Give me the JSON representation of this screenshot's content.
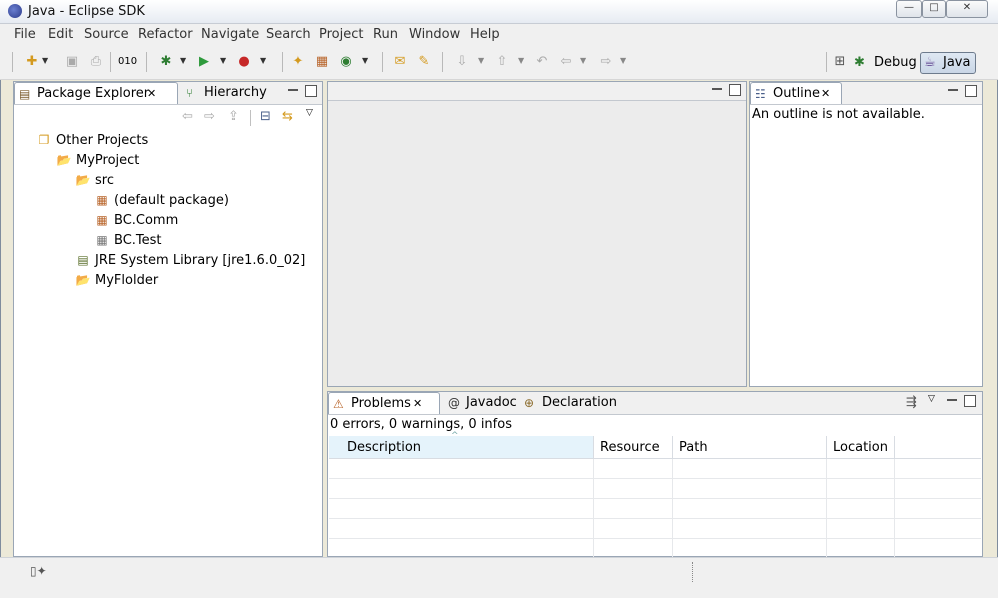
{
  "window": {
    "title": "Java - Eclipse SDK",
    "minimize": "—",
    "maximize": "□",
    "close": "✕"
  },
  "menu": [
    "File",
    "Edit",
    "Source",
    "Refactor",
    "Navigate",
    "Search",
    "Project",
    "Run",
    "Window",
    "Help"
  ],
  "perspectives": {
    "debug": "Debug",
    "java": "Java"
  },
  "package_explorer": {
    "tabs": [
      {
        "label": "Package Explorer",
        "close": "✕"
      },
      {
        "label": "Hierarchy"
      }
    ],
    "tree": [
      {
        "label": "Other Projects",
        "icon": "working-set-icon",
        "glyph": "❐"
      },
      {
        "label": "MyProject",
        "icon": "project-icon",
        "glyph": "📂"
      },
      {
        "label": "src",
        "icon": "source-folder-icon",
        "glyph": "📂"
      },
      {
        "label": "(default package)",
        "icon": "package-icon",
        "glyph": "▦"
      },
      {
        "label": "BC.Comm",
        "icon": "package-icon",
        "glyph": "▦"
      },
      {
        "label": "BC.Test",
        "icon": "empty-package-icon",
        "glyph": "▦"
      },
      {
        "label": "JRE System Library [jre1.6.0_02]",
        "icon": "library-icon",
        "glyph": "▤"
      },
      {
        "label": "MyFlolder",
        "icon": "folder-icon",
        "glyph": "📂"
      }
    ]
  },
  "outline": {
    "tab": "Outline",
    "close": "✕",
    "message": "An outline is not available."
  },
  "problems": {
    "tabs": [
      {
        "label": "Problems",
        "close": "✕"
      },
      {
        "label": "Javadoc"
      },
      {
        "label": "Declaration"
      }
    ],
    "summary": "0 errors, 0 warnings, 0 infos",
    "columns": [
      "Description",
      "Resource",
      "Path",
      "Location"
    ],
    "sort_indicator": "^"
  },
  "colors": {
    "accent": "#f0f0f0",
    "border": "#9aa6b5",
    "selection": "#e5f3fb"
  }
}
